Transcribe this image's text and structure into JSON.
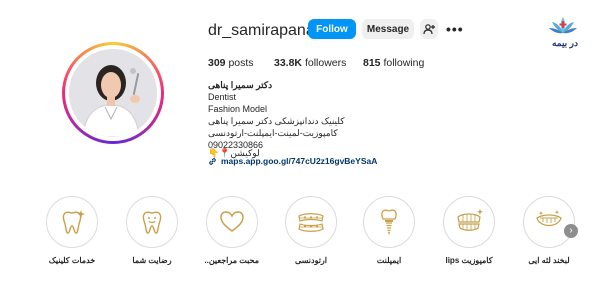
{
  "brand": {
    "text": "در بیمه",
    "icon": "lotus-cross-logo"
  },
  "profile": {
    "username": "dr_samirapanahi",
    "follow_label": "Follow",
    "message_label": "Message",
    "suggest_icon": "person-add-icon",
    "more_icon": "more-dots-icon"
  },
  "stats": {
    "posts_count": "309",
    "posts_label": "posts",
    "followers_count": "33.8K",
    "followers_label": "followers",
    "following_count": "815",
    "following_label": "following"
  },
  "bio": {
    "name": "دکتر سمیرا پناهی",
    "category": "Dentist",
    "line2": "Fashion Model",
    "line3": "کلینیک دندانپزشکی دکتر سمیرا پناهی",
    "line4": "کامپوزیت-لمینت-ایمپلنت-ارتودنسی",
    "phone": "09022330866",
    "location": "لوکیشن📍👇",
    "link": "maps.app.goo.gl/747cU2z16gvBeYSaA"
  },
  "highlights": [
    {
      "label": "خدمات کلینیک",
      "icon": "tooth-sparkle-icon"
    },
    {
      "label": "رضایت شما",
      "icon": "smiling-tooth-icon"
    },
    {
      "label": "محبت مراجعین...",
      "icon": "heart-icon"
    },
    {
      "label": "ارتودنسی",
      "icon": "braces-icon"
    },
    {
      "label": "ایمپلنت",
      "icon": "implant-icon"
    },
    {
      "label": "کامپوزیت lips",
      "icon": "teeth-arch-icon"
    },
    {
      "label": "لبخند لثه ایی",
      "icon": "gummy-smile-icon"
    }
  ],
  "colors": {
    "accent": "#0095f6",
    "gold": "#c8a04a",
    "link": "#00376b"
  }
}
